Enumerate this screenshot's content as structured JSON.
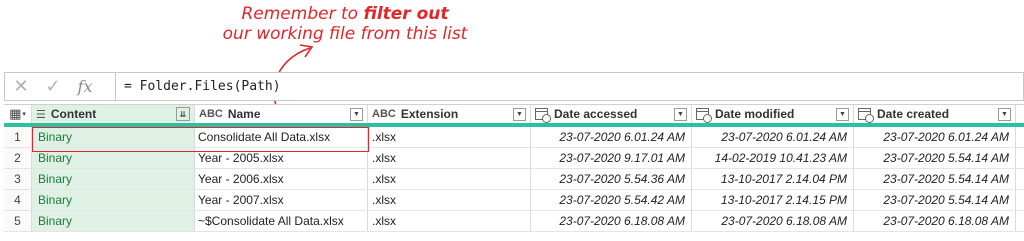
{
  "annotation": {
    "line1_prefix": "Remember to ",
    "line1_bold": "filter out",
    "line2": "our working file from this list"
  },
  "formula_bar": {
    "cancel_icon": "✕",
    "confirm_icon": "✓",
    "fx_label": "fx",
    "formula": "= Folder.Files(Path)"
  },
  "table": {
    "corner_icon": "table-menu-icon",
    "headers": {
      "content": "Content",
      "name": "Name",
      "extension": "Extension",
      "date_accessed": "Date accessed",
      "date_modified": "Date modified",
      "date_created": "Date created"
    },
    "type_icon_text": "ABC",
    "rows": [
      {
        "idx": "1",
        "content": "Binary",
        "name": "Consolidate All Data.xlsx",
        "ext": ".xlsx",
        "accessed": "23-07-2020 6.01.24 AM",
        "modified": "23-07-2020 6.01.24 AM",
        "created": "23-07-2020 6.01.24 AM"
      },
      {
        "idx": "2",
        "content": "Binary",
        "name": "Year - 2005.xlsx",
        "ext": ".xlsx",
        "accessed": "23-07-2020 9.17.01 AM",
        "modified": "14-02-2019 10.41.23 AM",
        "created": "23-07-2020 5.54.14 AM"
      },
      {
        "idx": "3",
        "content": "Binary",
        "name": "Year - 2006.xlsx",
        "ext": ".xlsx",
        "accessed": "23-07-2020 5.54.36 AM",
        "modified": "13-10-2017 2.14.04 PM",
        "created": "23-07-2020 5.54.14 AM"
      },
      {
        "idx": "4",
        "content": "Binary",
        "name": "Year - 2007.xlsx",
        "ext": ".xlsx",
        "accessed": "23-07-2020 5.54.42 AM",
        "modified": "13-10-2017 2.14.15 PM",
        "created": "23-07-2020 5.54.14 AM"
      },
      {
        "idx": "5",
        "content": "Binary",
        "name": "~$Consolidate All Data.xlsx",
        "ext": ".xlsx",
        "accessed": "23-07-2020 6.18.08 AM",
        "modified": "23-07-2020 6.18.08 AM",
        "created": "23-07-2020 6.18.08 AM"
      }
    ]
  },
  "colors": {
    "annotation": "#e0262a",
    "header_accent": "#2bc0a3",
    "content_column_bg": "#dff1e4",
    "content_text": "#1f7a3a"
  }
}
